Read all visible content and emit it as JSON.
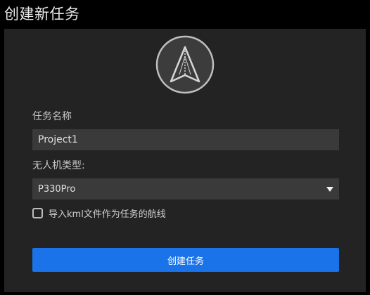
{
  "window": {
    "title": "创建新任务"
  },
  "logo": {
    "icon": "paper-plane-logo-icon"
  },
  "form": {
    "task_name_label": "任务名称",
    "task_name_value": "Project1",
    "drone_type_label": "无人机类型:",
    "drone_type_selected": "P330Pro",
    "import_kml_checked": false,
    "import_kml_label": "导入kml文件作为任务的航线",
    "submit_label": "创建任务"
  },
  "colors": {
    "background": "#000000",
    "panel": "#232323",
    "field": "#3a3a3a",
    "accent": "#1a73e8",
    "text": "#e0e0e0"
  }
}
